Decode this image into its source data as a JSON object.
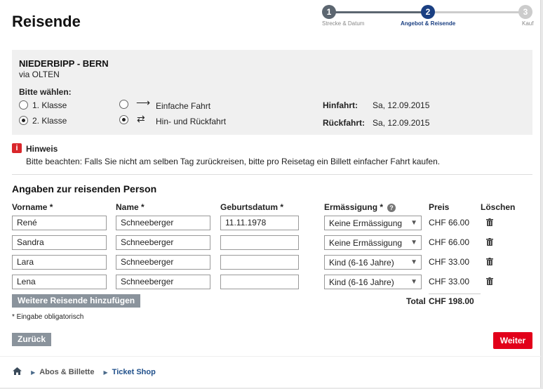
{
  "page": {
    "title": "Reisende"
  },
  "stepper": {
    "steps": [
      {
        "number": "1",
        "label": "Strecke & Datum"
      },
      {
        "number": "2",
        "label": "Angebot & Reisende"
      },
      {
        "number": "3",
        "label": "Kauf"
      }
    ],
    "active_step": 2,
    "colors": {
      "done": "#5c6670",
      "active": "#1a3f82",
      "pending": "#cccccc",
      "active_label": "#1a3f82"
    }
  },
  "route": {
    "title": "NIEDERBIPP - BERN",
    "via": "via OLTEN",
    "choose_label": "Bitte wählen:",
    "class_options": [
      {
        "label": "1. Klasse",
        "selected": false
      },
      {
        "label": "2. Klasse",
        "selected": true
      }
    ],
    "trip_options": [
      {
        "label": "Einfache Fahrt",
        "icon": "arrow-right-icon",
        "selected": false
      },
      {
        "label": "Hin- und Rückfahrt",
        "icon": "arrows-roundtrip-icon",
        "selected": true
      }
    ],
    "outbound_label": "Hinfahrt:",
    "outbound_date": "Sa, 12.09.2015",
    "return_label": "Rückfahrt:",
    "return_date": "Sa, 12.09.2015"
  },
  "hint": {
    "icon": "info-icon",
    "title": "Hinweis",
    "text": "Bitte beachten: Falls Sie nicht am selben Tag zurückreisen, bitte pro Reisetag ein Billett einfacher Fahrt kaufen."
  },
  "travellers": {
    "section_title": "Angaben zur reisenden Person",
    "headers": {
      "first_name": "Vorname *",
      "last_name": "Name *",
      "birthdate": "Geburtsdatum *",
      "discount": "Ermässigung *",
      "price": "Preis",
      "delete": "Löschen"
    },
    "rows": [
      {
        "first_name": "René",
        "last_name": "Schneeberger",
        "birthdate": "11.11.1978",
        "discount": "Keine Ermässigung",
        "price": "CHF 66.00"
      },
      {
        "first_name": "Sandra",
        "last_name": "Schneeberger",
        "birthdate": "",
        "discount": "Keine Ermässigung",
        "price": "CHF 66.00"
      },
      {
        "first_name": "Lara",
        "last_name": "Schneeberger",
        "birthdate": "",
        "discount": "Kind (6-16 Jahre)",
        "price": "CHF 33.00"
      },
      {
        "first_name": "Lena",
        "last_name": "Schneeberger",
        "birthdate": "",
        "discount": "Kind (6-16 Jahre)",
        "price": "CHF 33.00"
      }
    ],
    "add_button": "Weitere Reisende hinzufügen",
    "total_label": "Total",
    "total_value": "CHF 198.00",
    "mandatory_note": "* Eingabe obligatorisch"
  },
  "actions": {
    "back": "Zurück",
    "next": "Weiter"
  },
  "breadcrumb": {
    "home_icon": "home-icon",
    "items": [
      "Abos & Billette",
      "Ticket Shop"
    ]
  }
}
